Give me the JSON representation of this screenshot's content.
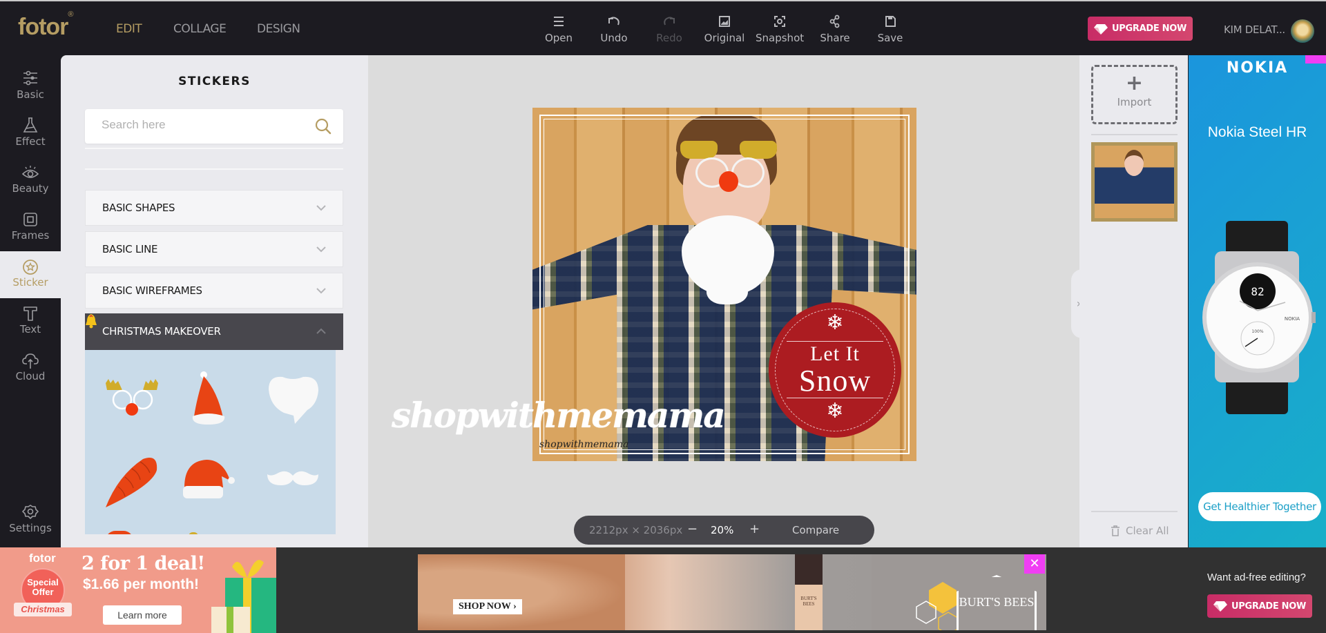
{
  "app": {
    "logo": "fotor",
    "logo_mark": "®",
    "nav": [
      {
        "label": "EDIT",
        "active": true
      },
      {
        "label": "COLLAGE",
        "active": false
      },
      {
        "label": "DESIGN",
        "active": false
      }
    ],
    "toolbar": [
      {
        "label": "Open",
        "icon": "menu-icon",
        "enabled": true
      },
      {
        "label": "Undo",
        "icon": "undo-icon",
        "enabled": true
      },
      {
        "label": "Redo",
        "icon": "redo-icon",
        "enabled": false
      },
      {
        "label": "Original",
        "icon": "image-icon",
        "enabled": true
      },
      {
        "label": "Snapshot",
        "icon": "snapshot-icon",
        "enabled": true
      },
      {
        "label": "Share",
        "icon": "share-icon",
        "enabled": true
      },
      {
        "label": "Save",
        "icon": "save-icon",
        "enabled": true
      }
    ],
    "upgrade_label": "UPGRADE NOW",
    "user_name": "KIM DELAT..."
  },
  "sidebar": {
    "items": [
      {
        "label": "Basic",
        "icon": "sliders-icon"
      },
      {
        "label": "Effect",
        "icon": "flask-icon"
      },
      {
        "label": "Beauty",
        "icon": "eye-icon"
      },
      {
        "label": "Frames",
        "icon": "frame-icon"
      },
      {
        "label": "Sticker",
        "icon": "star-badge-icon",
        "active": true
      },
      {
        "label": "Text",
        "icon": "text-icon"
      },
      {
        "label": "Cloud",
        "icon": "cloud-upload-icon"
      }
    ],
    "settings_label": "Settings"
  },
  "stickers_panel": {
    "title": "STICKERS",
    "search_placeholder": "Search here",
    "search_value": "",
    "categories": [
      {
        "label": "BASIC SHAPES",
        "expanded": false
      },
      {
        "label": "BASIC LINE",
        "expanded": false
      },
      {
        "label": "BASIC WIREFRAMES",
        "expanded": false
      },
      {
        "label": "CHRISTMAS MAKEOVER",
        "expanded": true,
        "badge": "bell-icon"
      }
    ],
    "christmas_stickers": [
      "reindeer-glasses-sticker",
      "santa-hat-tall-sticker",
      "white-beard-sticker",
      "carrot-nose-sticker",
      "santa-hat-sticker",
      "white-mustache-sticker"
    ]
  },
  "canvas": {
    "image_size": "2212px × 2036px",
    "zoom": "20%",
    "zoom_out": "−",
    "zoom_in": "+",
    "compare_label": "Compare",
    "badge_line1": "Let It",
    "badge_line2": "Snow",
    "watermark": "shopwithmemama",
    "watermark_small": "shopwithmemama"
  },
  "right_panel": {
    "import_label": "Import",
    "clear_all_label": "Clear All"
  },
  "ads": {
    "nokia": {
      "brand": "NOKIA",
      "product": "Nokia Steel HR",
      "watch_display": "82",
      "watch_sub": "100%",
      "cta": "Get Healthier Together"
    },
    "fotor_promo": {
      "brand": "fotor",
      "badge_line1": "Special",
      "badge_line2": "Offer",
      "ribbon": "Christmas",
      "headline": "2 for 1 deal!",
      "price": "$1.66 per month!",
      "cta": "Learn more"
    },
    "burts_bees": {
      "cta": "SHOP NOW ›",
      "brand": "BURT'S BEES",
      "close": "✕"
    },
    "adfree_prompt": "Want ad-free editing?",
    "adfree_cta": "UPGRADE NOW"
  },
  "colors": {
    "accent_gold": "#b59d63",
    "upgrade_pink": "#c82c66",
    "topbar": "#1c1b21",
    "panel_bg": "#eaeaee",
    "canvas_bg": "#dcdcdc",
    "badge_red": "#ac1c21",
    "ad_close_magenta": "#f03ef3"
  }
}
